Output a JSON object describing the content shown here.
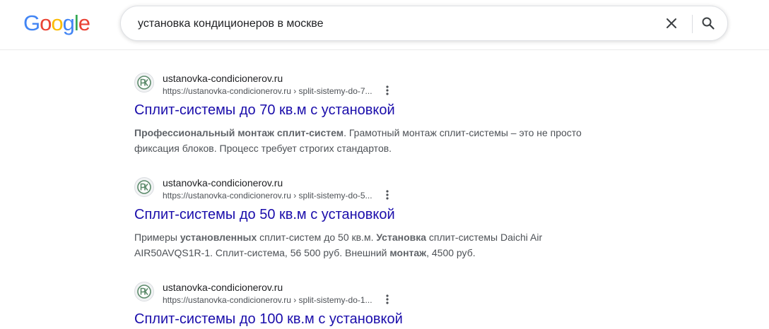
{
  "logo": {
    "letters": [
      "G",
      "o",
      "o",
      "g",
      "l",
      "e"
    ]
  },
  "colors": {
    "logo": [
      "#4285F4",
      "#EA4335",
      "#FBBC05",
      "#4285F4",
      "#34A853",
      "#EA4335"
    ],
    "link": "#1a0dab",
    "snippet": "#4d5156"
  },
  "search": {
    "value": "установка кондиционеров в москве"
  },
  "icons": {
    "clear": "close-icon",
    "search": "search-icon",
    "more": "more-vert-icon",
    "favicon": "pk-logo-icon"
  },
  "results": [
    {
      "site_name": "ustanovka-condicionerov.ru",
      "url": "https://ustanovka-condicionerov.ru",
      "path": " › split-sistemy-do-7...",
      "title": "Сплит-системы до 70 кв.м с установкой",
      "snippet": [
        {
          "text": "Профессиональный монтаж сплит-систем",
          "bold": true
        },
        {
          "text": ". Грамотный монтаж сплит-системы – это не просто фиксация блоков. Процесс требует строгих стандартов.",
          "bold": false
        }
      ]
    },
    {
      "site_name": "ustanovka-condicionerov.ru",
      "url": "https://ustanovka-condicionerov.ru",
      "path": " › split-sistemy-do-5...",
      "title": "Сплит-системы до 50 кв.м с установкой",
      "snippet": [
        {
          "text": "Примеры ",
          "bold": false
        },
        {
          "text": "установленных",
          "bold": true
        },
        {
          "text": " сплит-систем до 50 кв.м. ",
          "bold": false
        },
        {
          "text": "Установка",
          "bold": true
        },
        {
          "text": " сплит-системы Daichi Air AIR50AVQS1R-1. Сплит-система, 56 500 руб. Внешний ",
          "bold": false
        },
        {
          "text": "монтаж",
          "bold": true
        },
        {
          "text": ", 4500 руб.",
          "bold": false
        }
      ]
    },
    {
      "site_name": "ustanovka-condicionerov.ru",
      "url": "https://ustanovka-condicionerov.ru",
      "path": " › split-sistemy-do-1...",
      "title": "Сплит-системы до 100 кв.м с установкой",
      "snippet": []
    }
  ]
}
